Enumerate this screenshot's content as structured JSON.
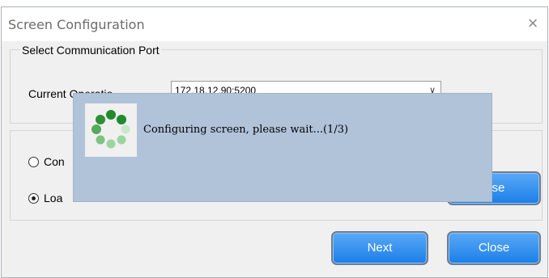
{
  "window": {
    "title": "Screen Configuration",
    "close_glyph": "×"
  },
  "port_group": {
    "legend": "Select Communication Port",
    "current_label": "Current Operatio",
    "current_value": "172.18.12.90:5200"
  },
  "options": {
    "option1_label": "Con",
    "option2_label": "Loa",
    "option1_selected": false,
    "option2_selected": true
  },
  "buttons": {
    "browse_label": "wse",
    "next_label": "Next",
    "close_label": "Close"
  },
  "progress_overlay": {
    "message": "Configuring screen, please wait...(1/3)",
    "icon": "loading-spinner-icon",
    "colors": {
      "overlay_bg": "#b1c3d9",
      "spinner_dark": "#1e8b2d",
      "spinner_light": "#9bd49f"
    }
  },
  "colors": {
    "button_top": "#5aa9f6",
    "button_bottom": "#1b7fe8",
    "window_bg": "#f0f0f0"
  }
}
